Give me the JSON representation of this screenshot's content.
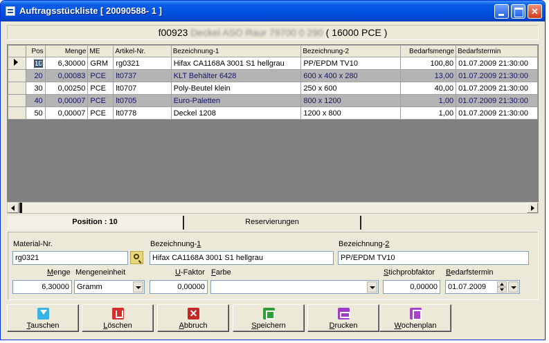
{
  "window": {
    "title": "Auftragsstückliste  [ 20090588- 1 ]",
    "minimize": "",
    "maximize": "",
    "close": "✕"
  },
  "header": {
    "prefix": "f00923",
    "blurred_name": "Deckel ASO Raur 79700 0 290",
    "quantity": "( 16000 PCE )"
  },
  "table": {
    "columns": [
      "Pos",
      "Menge",
      "ME",
      "Artikel-Nr.",
      "Bezeichnung-1",
      "Bezeichnung-2",
      "Bedarfsmenge",
      "Bedarfstermin"
    ],
    "rows": [
      {
        "pos": "10",
        "menge": "6,30000",
        "me": "GRM",
        "artikel": "rg0321",
        "bez1": "Hifax CA1168A 3001 S1 hellgrau",
        "bez2": "PP/EPDM TV10",
        "bedarfsmenge": "100,80",
        "termin": "01.07.2009 21:30:00"
      },
      {
        "pos": "20",
        "menge": "0,00083",
        "me": "PCE",
        "artikel": "lt0737",
        "bez1": "KLT Behälter 6428",
        "bez2": "600 x 400 x 280",
        "bedarfsmenge": "13,00",
        "termin": "01.07.2009 21:30:00"
      },
      {
        "pos": "30",
        "menge": "0,00250",
        "me": "PCE",
        "artikel": "lt0707",
        "bez1": "Poly-Beutel klein",
        "bez2": "250 x 600",
        "bedarfsmenge": "40,00",
        "termin": "01.07.2009 21:30:00"
      },
      {
        "pos": "40",
        "menge": "0,00007",
        "me": "PCE",
        "artikel": "lt0705",
        "bez1": "Euro-Paletten",
        "bez2": "800 x 1200",
        "bedarfsmenge": "1,00",
        "termin": "01.07.2009 21:30:00"
      },
      {
        "pos": "50",
        "menge": "0,00007",
        "me": "PCE",
        "artikel": "lt0778",
        "bez1": "Deckel 1208",
        "bez2": "1200 x 800",
        "bedarfsmenge": "1,00",
        "termin": "01.07.2009 21:30:00"
      }
    ]
  },
  "tabs": {
    "position": "Position : 10",
    "reservierungen": "Reservierungen",
    "empty": ""
  },
  "form": {
    "material_label": "Material-Nr.",
    "material_value": "rg0321",
    "bez1_label_a": "Bezeichnung-",
    "bez1_label_b": "1",
    "bez1_value": "Hifax CA1168A 3001 S1 hellgrau",
    "bez2_label_a": "Bezeichnung-",
    "bez2_label_b": "2",
    "bez2_value": "PP/EPDM TV10",
    "menge_label_a": "M",
    "menge_label_b": "enge",
    "mengeneinheit_label": "Mengeneinheit",
    "menge_value": "6,30000",
    "einheit_value": "Gramm",
    "ufaktor_label_a": "U",
    "ufaktor_label_b": "-Faktor",
    "ufaktor_value": "0,00000",
    "farbe_label_a": "F",
    "farbe_label_b": "arbe",
    "farbe_value": "",
    "stichprobe_label_a": "S",
    "stichprobe_label_b": "tichprobfaktor",
    "stichprobe_value": "0,00000",
    "termin_label_a": "B",
    "termin_label_b": "edarfstermin",
    "termin_value": "01.07.2009"
  },
  "buttons": {
    "tauschen_a": "T",
    "tauschen_b": "auschen",
    "loeschen_a": "L",
    "loeschen_b": "öschen",
    "abbruch_a": "A",
    "abbruch_b": "bbruch",
    "speichern_a": "S",
    "speichern_b": "peichern",
    "drucken_a": "D",
    "drucken_b": "rucken",
    "wochenplan_a": "W",
    "wochenplan_b": "ochenplan",
    "abbruch_icon": "✕"
  }
}
